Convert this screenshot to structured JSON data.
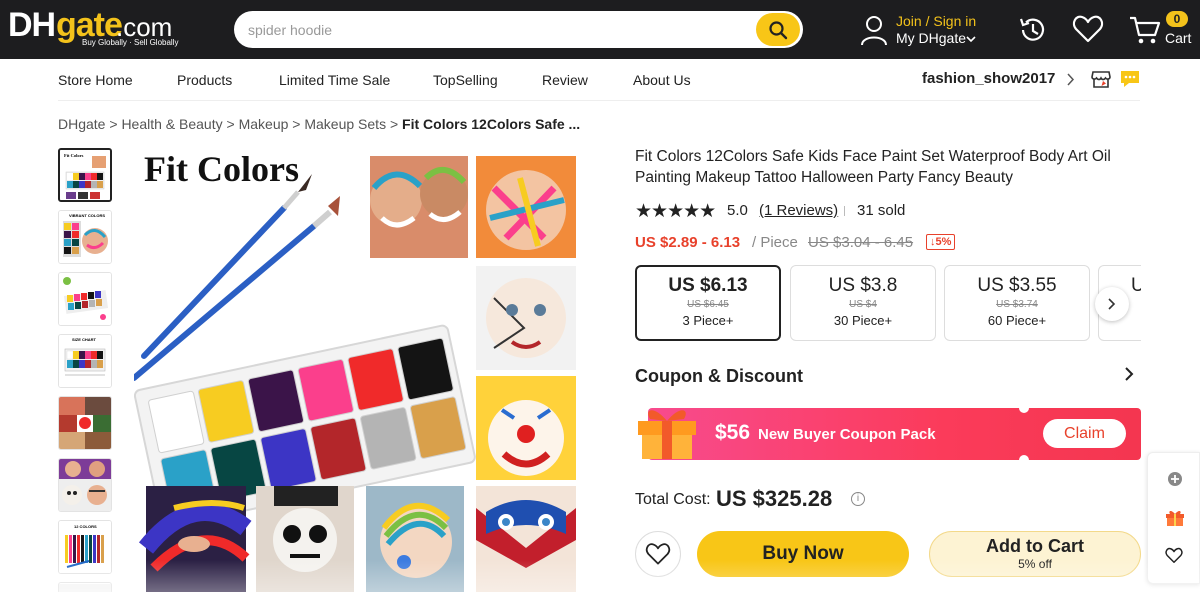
{
  "header": {
    "logo": {
      "dh": "DH",
      "gate": "gate",
      "dotcom": ".com",
      "slogan": "Buy Globally · Sell Globally"
    },
    "search": {
      "placeholder": "spider hoodie"
    },
    "account": {
      "join": "Join / Sign in",
      "my": "My DHgate"
    },
    "cart": {
      "count": "0",
      "label": "Cart"
    }
  },
  "store_nav": {
    "items": [
      "Store Home",
      "Products",
      "Limited Time Sale",
      "TopSelling",
      "Review",
      "About Us"
    ],
    "store_name": "fashion_show2017"
  },
  "breadcrumb": {
    "items": [
      "DHgate",
      "Health & Beauty",
      "Makeup",
      "Makeup Sets"
    ],
    "separator": " > ",
    "current": "Fit Colors 12Colors Safe ..."
  },
  "gallery": {
    "brand_text": "Fit Colors",
    "thumb_labels": [
      "",
      "VIBRANT COLORS",
      "",
      "SIZE CHART",
      "",
      "",
      "12 COLORS"
    ],
    "palette_colors": [
      "#ffffff",
      "#f7cc21",
      "#3b1449",
      "#fb3f8c",
      "#f02a2a",
      "#141414",
      "#2aa1c8",
      "#074643",
      "#3c35c5",
      "#b3262a",
      "#b4b4b4",
      "#d9a04b"
    ]
  },
  "product": {
    "title": "Fit Colors 12Colors Safe Kids Face Paint Set Waterproof Body Art Oil Painting Makeup Tattoo Halloween Party Fancy Beauty",
    "rating": {
      "stars": "★★★★★",
      "score": "5.0",
      "reviews": "(1 Reviews)",
      "sold": "31 sold"
    },
    "price": {
      "range": "US $2.89 - 6.13",
      "unit": "/ Piece",
      "original": "US $3.04 - 6.45",
      "discount": "↓5%"
    },
    "tiers": [
      {
        "price": "US $6.13",
        "original": "US $6.45",
        "qty": "3 Piece+"
      },
      {
        "price": "US $3.8",
        "original": "US $4",
        "qty": "30 Piece+"
      },
      {
        "price": "US $3.55",
        "original": "US $3.74",
        "qty": "60 Piece+"
      },
      {
        "price": "U",
        "original": "",
        "qty": ""
      }
    ],
    "coupon": {
      "heading": "Coupon & Discount",
      "amount": "$56",
      "description": "New Buyer Coupon Pack",
      "claim": "Claim"
    },
    "total": {
      "label": "Total Cost:",
      "value": "US $325.28",
      "info": "i"
    },
    "actions": {
      "buy_now": "Buy Now",
      "add_to_cart": "Add to Cart",
      "add_to_cart_sub": "5% off"
    }
  },
  "colors": {
    "header_bg": "#1d1d1f",
    "accent_yellow": "#f8c617",
    "price_red": "#e8412b",
    "coupon_pink": "#fb3b5a"
  }
}
